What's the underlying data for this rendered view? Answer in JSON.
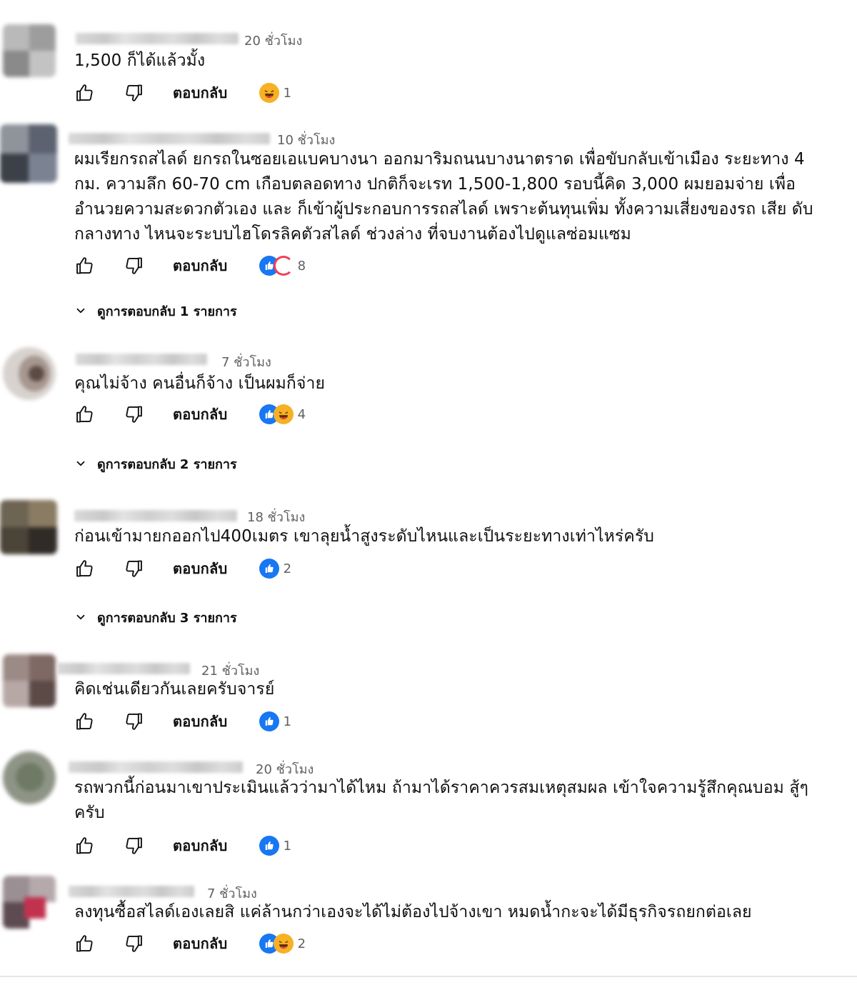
{
  "reply_label": "ตอบกลับ",
  "comments": [
    {
      "time": "20 ชั่วโมง",
      "text": "1,500 ก็ได้แล้วมั้ง",
      "reactions": [
        "haha"
      ],
      "reaction_count": "1"
    },
    {
      "time": "10 ชั่วโมง",
      "text": "ผมเรียกรถสไลด์ ยกรถในซอยเอแบคบางนา ออกมาริมถนนบางนาตราด เพื่อขับกลับเข้าเมือง ระยะทาง 4 กม. ความลึก 60-70 cm เกือบตลอดทาง ปกติก็จะเรท 1,500-1,800 รอบนี้คิด 3,000 ผมยอมจ่าย เพื่ออำนวยความสะดวกตัวเอง และ ก็เข้าผู้ประกอบการรถสไลด์ เพราะต้นทุนเพิ่ม ทั้งความเสี่ยงของรถ เสีย ดับกลางทาง ไหนจะระบบไฮโดรลิคตัวสไลด์ ช่วงล่าง ที่จบงานต้องไปดูแลซ่อมแซม",
      "reactions": [
        "like",
        "love"
      ],
      "reaction_count": "8",
      "view_replies": "ดูการตอบกลับ 1 รายการ"
    },
    {
      "time": "7 ชั่วโมง",
      "text": "คุณไม่จ้าง คนอื่นก็จ้าง เป็นผมก็จ่าย",
      "reactions": [
        "like",
        "haha"
      ],
      "reaction_count": "4",
      "view_replies": "ดูการตอบกลับ 2 รายการ"
    },
    {
      "time": "18 ชั่วโมง",
      "text": "ก่อนเข้ามายกออกไป400เมตร เขาลุยน้ำสูงระดับไหนและเป็นระยะทางเท่าไหร่ครับ",
      "reactions": [
        "like"
      ],
      "reaction_count": "2",
      "view_replies": "ดูการตอบกลับ 3 รายการ"
    },
    {
      "time": "21 ชั่วโมง",
      "text": "คิดเช่นเดียวกันเลยครับจารย์",
      "reactions": [
        "like"
      ],
      "reaction_count": "1"
    },
    {
      "time": "20 ชั่วโมง",
      "text": "รถพวกนี้ก่อนมาเขาประเมินแล้วว่ามาได้ไหม ถ้ามาได้ราคาควรสมเหตุสมผล เข้าใจความรู้สึกคุณบอม สู้ๆครับ",
      "reactions": [
        "like"
      ],
      "reaction_count": "1"
    },
    {
      "time": "7 ชั่วโมง",
      "text": "ลงทุนซื้อสไลด์เองเลยสิ แค่ล้านกว่าเองจะได้ไม่ต้องไปจ้างเขา หมดน้ำกะจะได้มีธุรกิจรถยกต่อเลย",
      "reactions": [
        "like",
        "haha"
      ],
      "reaction_count": "2"
    }
  ],
  "colors": {
    "like_blue": "#1877f2",
    "love_red": "#f33e58",
    "haha_yellow": "#f7b125",
    "muted_text": "#606060"
  },
  "icons": {
    "like": "thumbs-up-icon",
    "dislike": "thumbs-down-icon",
    "chevron": "chevron-down-icon"
  }
}
